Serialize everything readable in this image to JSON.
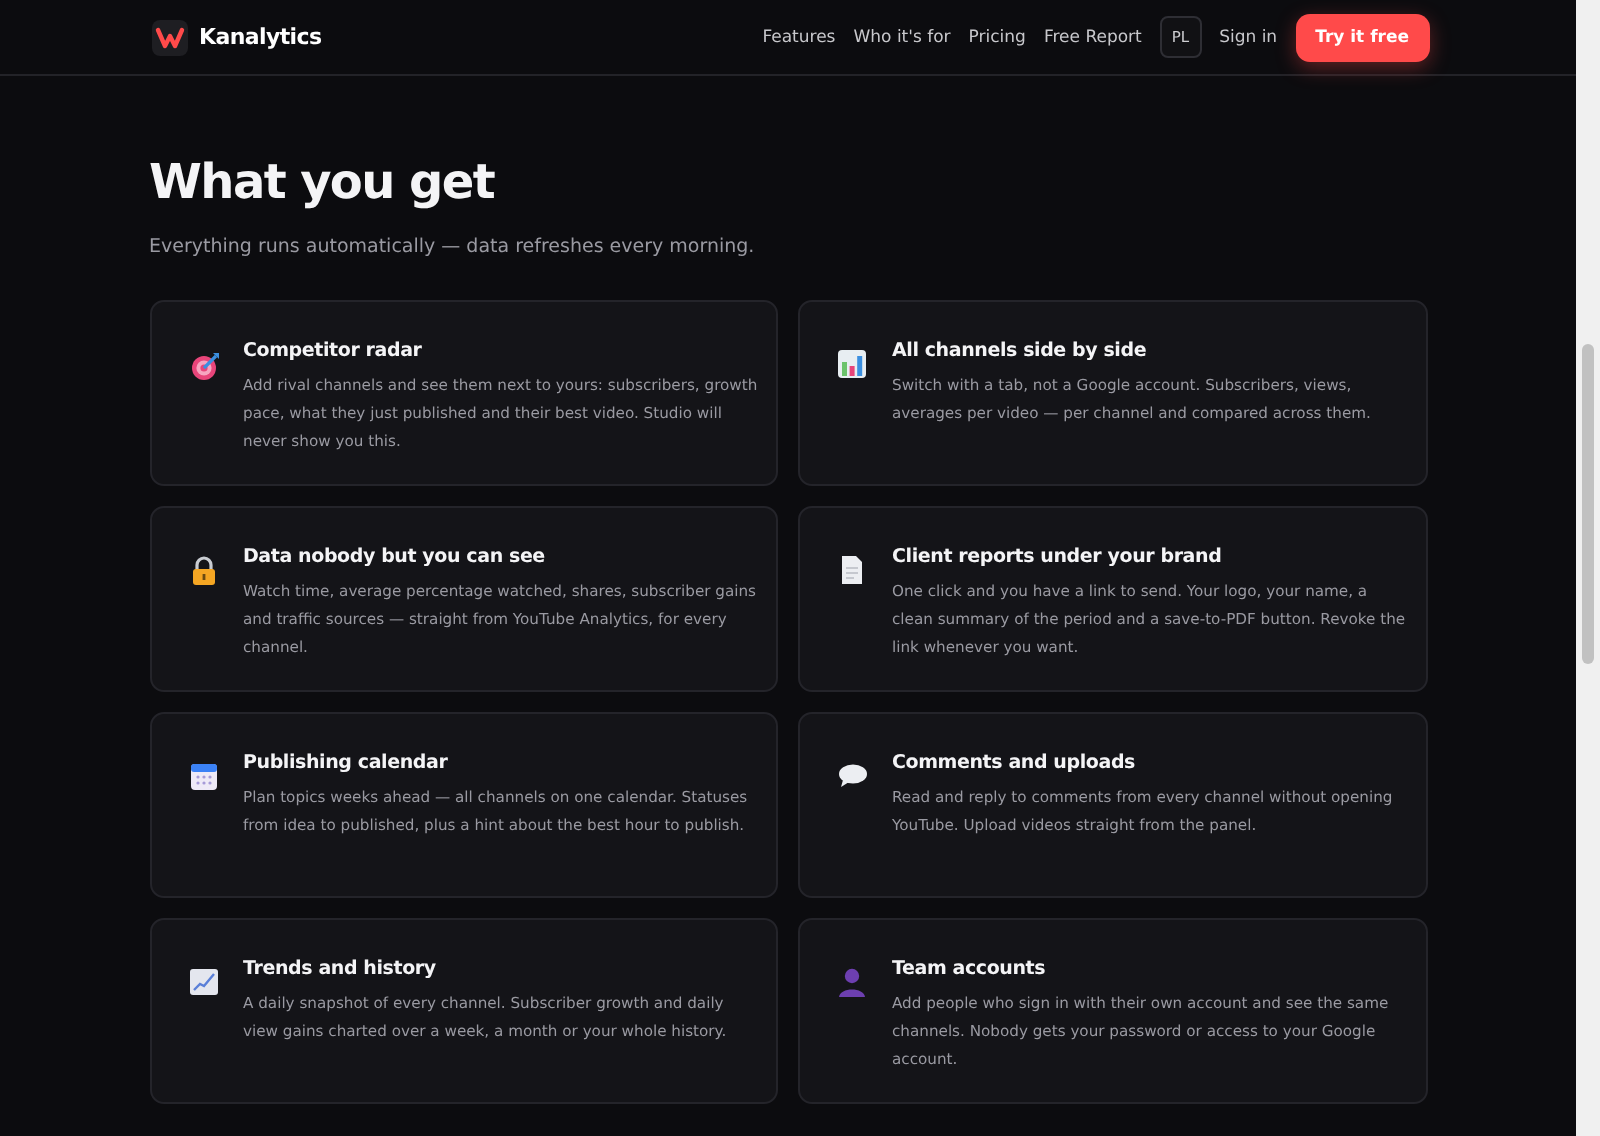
{
  "header": {
    "brand": "Kanalytics",
    "nav": [
      "Features",
      "Who it's for",
      "Pricing",
      "Free Report"
    ],
    "language": "PL",
    "sign_in": "Sign in",
    "cta": "Try it free"
  },
  "section": {
    "title": "What you get",
    "subtitle": "Everything runs automatically — data refreshes every morning."
  },
  "features": [
    {
      "kind": "target",
      "title": "Competitor radar",
      "text": "Add rival channels and see them next to yours: subscribers, growth pace, what they just published and their best video. Studio will never show you this."
    },
    {
      "kind": "bars",
      "title": "All channels side by side",
      "text": "Switch with a tab, not a Google account. Subscribers, views, averages per video — per channel and compared across them."
    },
    {
      "kind": "lock",
      "title": "Data nobody but you can see",
      "text": "Watch time, average percentage watched, shares, subscriber gains and traffic sources — straight from YouTube Analytics, for every channel."
    },
    {
      "kind": "document",
      "title": "Client reports under your brand",
      "text": "One click and you have a link to send. Your logo, your name, a clean summary of the period and a save-to-PDF button. Revoke the link whenever you want."
    },
    {
      "kind": "calendar",
      "title": "Publishing calendar",
      "text": "Plan topics weeks ahead — all channels on one calendar. Statuses from idea to published, plus a hint about the best hour to publish."
    },
    {
      "kind": "speech",
      "title": "Comments and uploads",
      "text": "Read and reply to comments from every channel without opening YouTube. Upload videos straight from the panel."
    },
    {
      "kind": "trend",
      "title": "Trends and history",
      "text": "A daily snapshot of every channel. Subscriber growth and daily view gains charted over a week, a month or your whole history."
    },
    {
      "kind": "person",
      "title": "Team accounts",
      "text": "Add people who sign in with their own account and see the same channels. Nobody gets your password or access to your Google account."
    }
  ]
}
